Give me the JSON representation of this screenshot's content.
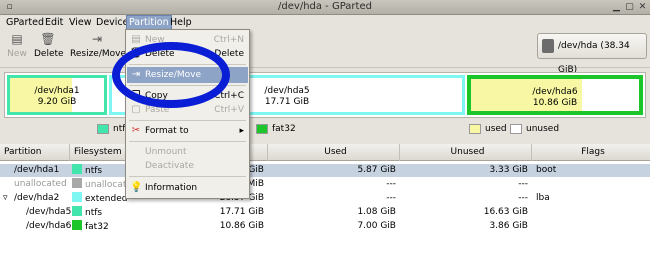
{
  "window": {
    "title": "/dev/hda - GParted"
  },
  "menubar": [
    "GParted",
    "Edit",
    "View",
    "Device",
    "Partition",
    "Help"
  ],
  "toolbar": {
    "new": "New",
    "delete": "Delete",
    "resize": "Resize/Move",
    "device": "/dev/hda  (38.34 GiB)"
  },
  "disk": {
    "hda1": {
      "name": "/dev/hda1",
      "size": "9.20 GiB"
    },
    "hda5": {
      "name": "/dev/hda5",
      "size": "17.71 GiB"
    },
    "hda6": {
      "name": "/dev/hda6",
      "size": "10.86 GiB"
    }
  },
  "legend": {
    "ntfs": "ntfs",
    "fat32": "fat32",
    "used": "used",
    "unused": "unused"
  },
  "colors": {
    "ntfs": "#42e5ac",
    "extended": "#7ef7f3",
    "fat32": "#1cc62a",
    "used": "#f8f8a4",
    "unallocated": "#a8a8a8",
    "accent": "#0a1ed6"
  },
  "columns": [
    "Partition",
    "Filesystem",
    "Size",
    "Used",
    "Unused",
    "Flags"
  ],
  "rows": [
    {
      "partition": "/dev/hda1",
      "fs": "ntfs",
      "size": "9.20 GiB",
      "used": "5.87 GiB",
      "unused": "3.33 GiB",
      "flags": "boot"
    },
    {
      "partition": "unallocated",
      "fs": "unallocated",
      "size": "MiB",
      "used": "---",
      "unused": "---",
      "flags": ""
    },
    {
      "partition": "/dev/hda2",
      "fs": "extended",
      "size": "28.57 GiB",
      "used": "---",
      "unused": "---",
      "flags": "lba"
    },
    {
      "partition": "/dev/hda5",
      "fs": "ntfs",
      "size": "17.71 GiB",
      "used": "1.08 GiB",
      "unused": "16.63 GiB",
      "flags": ""
    },
    {
      "partition": "/dev/hda6",
      "fs": "fat32",
      "size": "10.86 GiB",
      "used": "7.00 GiB",
      "unused": "3.86 GiB",
      "flags": ""
    }
  ],
  "partition_menu": {
    "new": "New",
    "new_acc": "Ctrl+N",
    "delete": "Delete",
    "delete_acc": "Delete",
    "resize": "Resize/Move",
    "copy": "Copy",
    "copy_acc": "Ctrl+C",
    "paste": "Paste",
    "paste_acc": "Ctrl+V",
    "format": "Format to",
    "unmount": "Unmount",
    "deactivate": "Deactivate",
    "information": "Information"
  }
}
